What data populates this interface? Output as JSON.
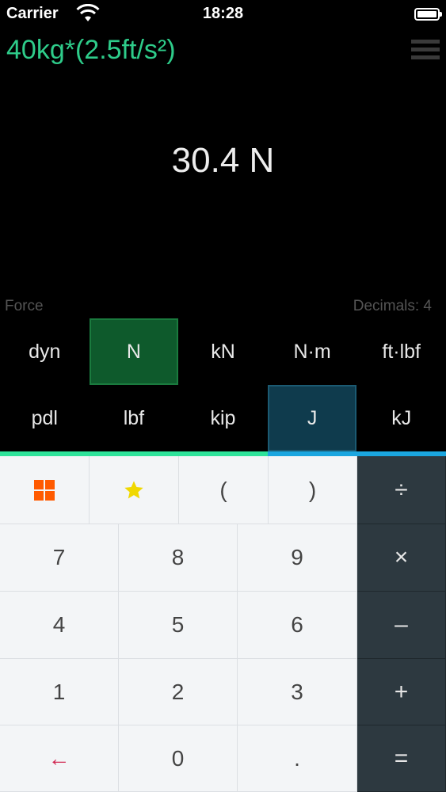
{
  "status_bar": {
    "carrier": "Carrier",
    "time": "18:28"
  },
  "expression": "40kg*(2.5ft/s²)",
  "result": "30.4 N",
  "category": "Force",
  "decimals": "Decimals: 4",
  "units": [
    {
      "label": "dyn",
      "state": "none"
    },
    {
      "label": "N",
      "state": "from"
    },
    {
      "label": "kN",
      "state": "none"
    },
    {
      "label": "N·m",
      "state": "none"
    },
    {
      "label": "ft·lbf",
      "state": "none"
    },
    {
      "label": "pdl",
      "state": "none"
    },
    {
      "label": "lbf",
      "state": "none"
    },
    {
      "label": "kip",
      "state": "none"
    },
    {
      "label": "J",
      "state": "to"
    },
    {
      "label": "kJ",
      "state": "none"
    }
  ],
  "keypad": {
    "row0": [
      "(",
      ")"
    ],
    "digits": [
      "7",
      "8",
      "9",
      "4",
      "5",
      "6",
      "1",
      "2",
      "3"
    ],
    "backspace": "←",
    "zero": "0",
    "dot": ".",
    "ops": [
      "÷",
      "×",
      "–",
      "+",
      "="
    ]
  },
  "colors": {
    "expression": "#2ecc8a",
    "from_unit_bg": "#0e5a2c",
    "to_unit_bg": "#0f3b4d",
    "accent_green": "#2ee39a",
    "accent_blue": "#1aa6e0",
    "grid_icon": "#ff5a00",
    "star_icon": "#f0d800",
    "backspace": "#d0244f"
  }
}
